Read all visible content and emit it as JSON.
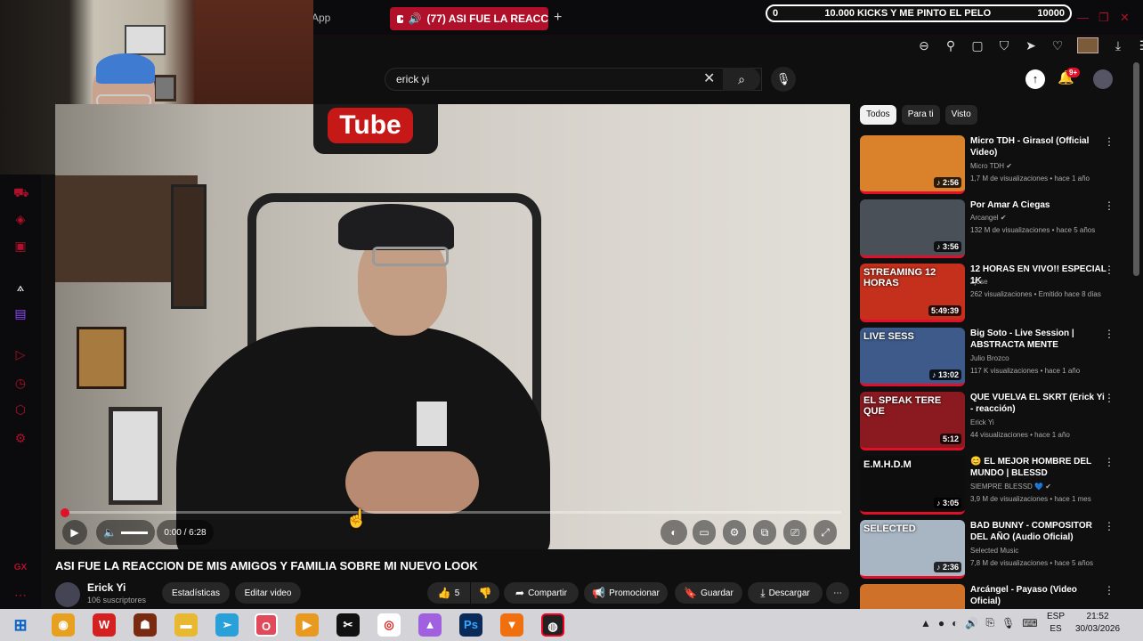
{
  "browser": {
    "app_label": "App",
    "tab_title": "(77) ASI FUE LA REACC",
    "new_tab": "+",
    "kicks_left": "0",
    "kicks_goal": "10.000 KICKS Y ME PINTO EL PELO",
    "kicks_right": "10000"
  },
  "youtube": {
    "search_value": "erick yi",
    "notif_badge": "9+",
    "player": {
      "logo_text": "Tube",
      "time": "0:00 / 6:28",
      "progress_fraction": 0.0
    },
    "video": {
      "title": "ASI FUE LA REACCION DE MIS AMIGOS Y FAMILIA SOBRE MI NUEVO LOOK",
      "channel": "Erick Yi",
      "subscribers": "106 suscriptores",
      "likes": "5",
      "actions": {
        "stats": "Estadísticas",
        "edit": "Editar video",
        "share": "Compartir",
        "promote": "Promocionar",
        "save": "Guardar",
        "download": "Descargar"
      }
    },
    "chips": [
      "Todos",
      "Para ti",
      "Visto"
    ],
    "recommendations": [
      {
        "title": "Micro TDH - Girasol (Official Video)",
        "channel": "Micro TDH",
        "verified": true,
        "meta": "1,7 M de visualizaciones • hace 1 año",
        "duration": "♪ 2:56",
        "color": "#d9822b"
      },
      {
        "title": "Por Amar A Ciegas",
        "channel": "Arcangel",
        "verified": true,
        "meta": "132 M de visualizaciones • hace 5 años",
        "duration": "♪ 3:56",
        "color": "#4a5058"
      },
      {
        "title": "12 HORAS EN VIVO!! ESPECIAL 1K",
        "channel": "Zjose",
        "verified": false,
        "meta": "262 visualizaciones • Emitido hace 8 días",
        "duration": "5:49:39",
        "color": "#c4301c",
        "thumb_text": "STREAMING 12 HORAS"
      },
      {
        "title": "Big Soto - Live Session | ABSTRACTA MENTE",
        "channel": "Julio Brozco",
        "verified": false,
        "meta": "117 K visualizaciones • hace 1 año",
        "duration": "♪ 13:02",
        "color": "#3d5a8a",
        "thumb_text": "LIVE SESS"
      },
      {
        "title": "QUE VUELVA EL SKRT (Erick Yi - reacción)",
        "channel": "Erick Yi",
        "verified": false,
        "meta": "44 visualizaciones • hace 1 año",
        "duration": "5:12",
        "color": "#8a1a20",
        "thumb_text": "EL SPEAK TERE QUE"
      },
      {
        "title": "😊 EL MEJOR HOMBRE DEL MUNDO | BLESSD",
        "channel": "SIEMPRE BLESSD 💙",
        "verified": true,
        "meta": "3,9 M de visualizaciones • hace 1 mes",
        "duration": "♪ 3:05",
        "color": "#0d0d0d",
        "thumb_text": "E.M.H.D.M"
      },
      {
        "title": "BAD BUNNY - COMPOSITOR DEL AÑO (Audio Oficial)",
        "channel": "Selected Music",
        "verified": false,
        "meta": "7,8 M de visualizaciones • hace 5 años",
        "duration": "♪ 2:36",
        "color": "#a8b6c4",
        "thumb_text": "SELECTED"
      },
      {
        "title": "Arcángel - Payaso (Video Oficial)",
        "channel": "",
        "verified": false,
        "meta": "",
        "duration": "",
        "color": "#d0712a"
      }
    ]
  },
  "taskbar": {
    "language": "ESP",
    "language_sub": "ES",
    "time": "21:52",
    "date": "30/03/2026"
  }
}
